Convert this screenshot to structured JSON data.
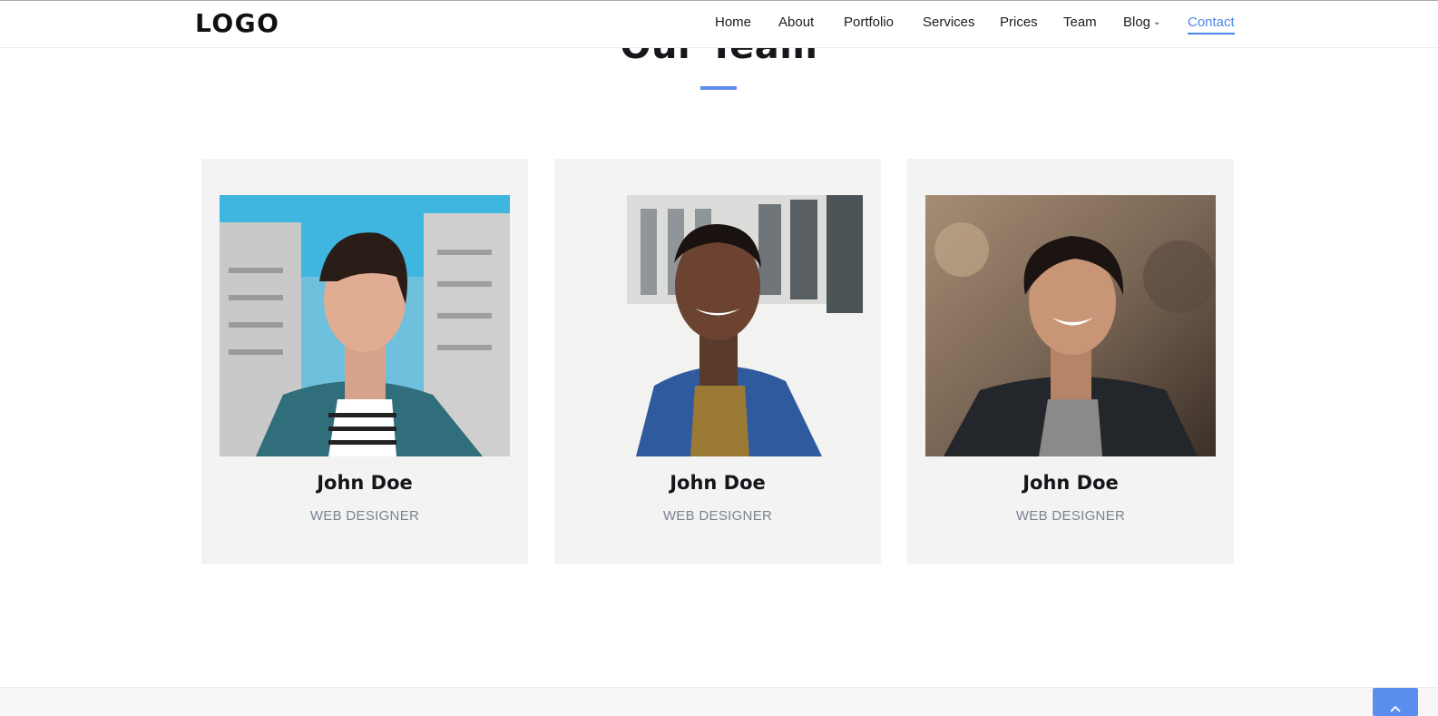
{
  "header": {
    "logo": "LOGO",
    "nav": [
      {
        "label": "Home"
      },
      {
        "label": "About"
      },
      {
        "label": "Portfolio"
      },
      {
        "label": "Services"
      },
      {
        "label": "Prices"
      },
      {
        "label": "Team"
      },
      {
        "label": "Blog",
        "has_dropdown": true
      },
      {
        "label": "Contact",
        "active": true
      }
    ],
    "accent_color": "#5b8def"
  },
  "team": {
    "title": "Our Team",
    "members": [
      {
        "name": "John Doe",
        "role": "WEB DESIGNER"
      },
      {
        "name": "John Doe",
        "role": "WEB DESIGNER"
      },
      {
        "name": "John Doe",
        "role": "WEB DESIGNER"
      }
    ]
  },
  "scroll_top": {
    "icon": "chevron-up-icon"
  }
}
